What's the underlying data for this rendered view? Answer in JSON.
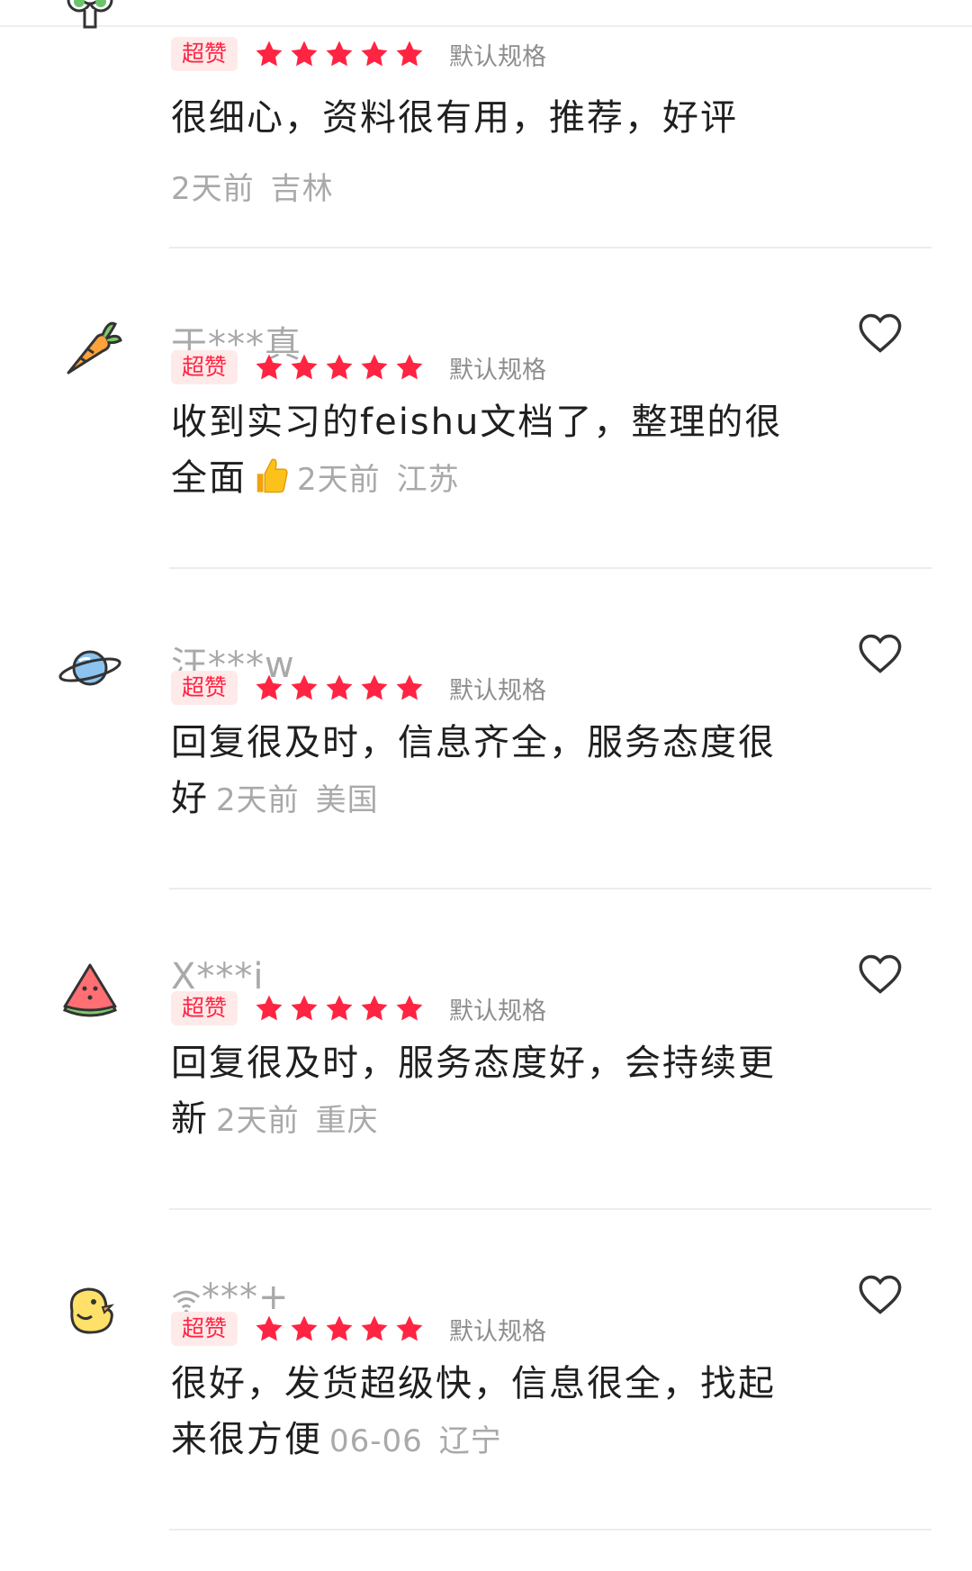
{
  "reviews": [
    {
      "username": "",
      "avatar_icon": "broccoli-icon",
      "badge": "超赞",
      "stars": 5,
      "spec": "默认规格",
      "content": "很细心，资料很有用，推荐，好评",
      "time": "2天前",
      "location": "吉林"
    },
    {
      "username": "于***真",
      "avatar_icon": "carrot-icon",
      "badge": "超赞",
      "stars": 5,
      "spec": "默认规格",
      "content": "收到实习的feishu文档了，整理的很全面",
      "emoji_icon": "thumbs-up-icon",
      "time": "2天前",
      "location": "江苏"
    },
    {
      "username": "汪***w",
      "avatar_icon": "planet-icon",
      "badge": "超赞",
      "stars": 5,
      "spec": "默认规格",
      "content": "回复很及时，信息齐全，服务态度很好",
      "time": "2天前",
      "location": "美国"
    },
    {
      "username": "X***i",
      "avatar_icon": "watermelon-icon",
      "badge": "超赞",
      "stars": 5,
      "spec": "默认规格",
      "content": "回复很及时，服务态度好，会持续更新",
      "time": "2天前",
      "location": "重庆"
    },
    {
      "username": "***+",
      "username_prefix_icon": "wifi-icon",
      "avatar_icon": "chick-icon",
      "badge": "超赞",
      "stars": 5,
      "spec": "默认规格",
      "content": "很好，发货超级快，信息很全，找起来很方便",
      "time": "06-06",
      "location": "辽宁"
    }
  ],
  "colors": {
    "accent": "#ff2442",
    "badge_bg": "#ffeaea",
    "meta_text": "#a9a9a9",
    "divider": "#ececec"
  }
}
